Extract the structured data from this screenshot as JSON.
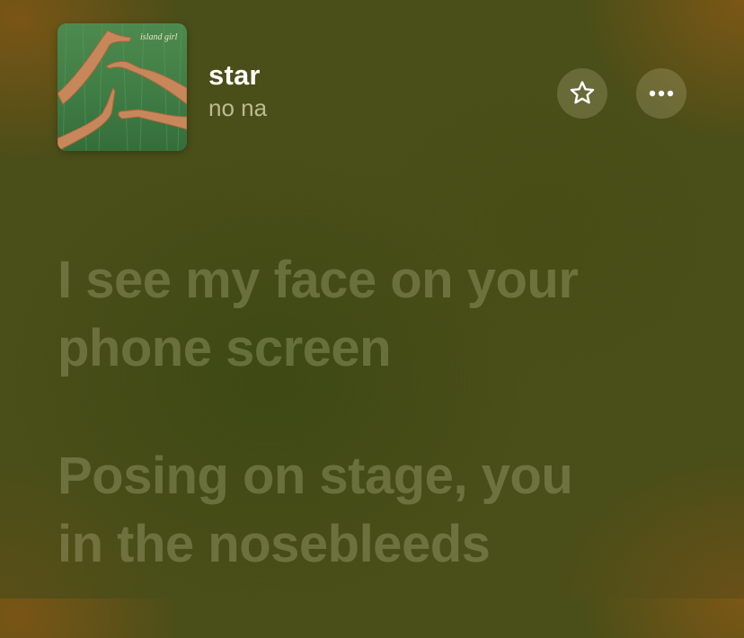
{
  "now_playing": {
    "artwork": {
      "text": "island girl",
      "icon": "album-art"
    },
    "title": "star",
    "artist": "no na",
    "favorite_icon": "star-outline-icon",
    "more_icon": "ellipsis-icon"
  },
  "lyrics": [
    "I see my face on your\nphone screen",
    "Posing on stage, you\nin the nosebleeds"
  ],
  "colors": {
    "background": "#4a4e18",
    "title": "#ffffff",
    "artist": "#b8b894",
    "lyric_inactive": "#6b7040",
    "button_bg": "#6b6a36"
  }
}
